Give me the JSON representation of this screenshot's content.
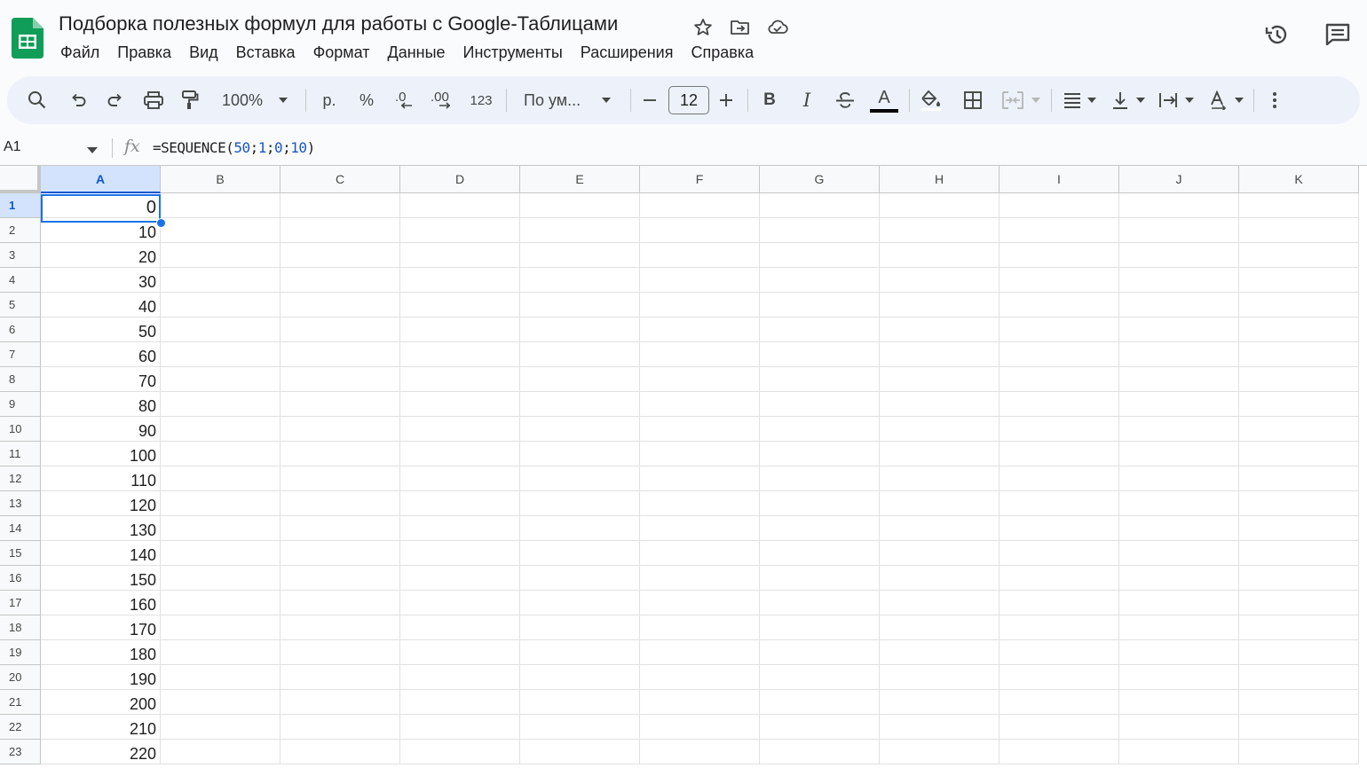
{
  "document": {
    "title": "Подборка полезных формул для работы с Google-Таблицами"
  },
  "menu": [
    "Файл",
    "Правка",
    "Вид",
    "Вставка",
    "Формат",
    "Данные",
    "Инструменты",
    "Расширения",
    "Справка"
  ],
  "toolbar": {
    "zoom": "100%",
    "currency": "р.",
    "percent": "%",
    "decrease_decimal": ".0",
    "increase_decimal": ".00",
    "number_format": "123",
    "font": "По ум...",
    "font_size": "12",
    "bold": "B",
    "italic": "I",
    "text_color": "A"
  },
  "formula_bar": {
    "cell_ref": "A1",
    "fx": "fx",
    "formula_prefix": "=SEQUENCE(",
    "arg1": "50",
    "sep1": ";",
    "arg2": "1",
    "sep2": ";",
    "arg3": "0",
    "sep3": ";",
    "arg4": "10",
    "formula_suffix": ")"
  },
  "grid": {
    "columns": [
      "A",
      "B",
      "C",
      "D",
      "E",
      "F",
      "G",
      "H",
      "I",
      "J",
      "K"
    ],
    "selected_column": "A",
    "selected_row": 1,
    "rows": [
      {
        "n": "1",
        "a": "0"
      },
      {
        "n": "2",
        "a": "10"
      },
      {
        "n": "3",
        "a": "20"
      },
      {
        "n": "4",
        "a": "30"
      },
      {
        "n": "5",
        "a": "40"
      },
      {
        "n": "6",
        "a": "50"
      },
      {
        "n": "7",
        "a": "60"
      },
      {
        "n": "8",
        "a": "70"
      },
      {
        "n": "9",
        "a": "80"
      },
      {
        "n": "10",
        "a": "90"
      },
      {
        "n": "11",
        "a": "100"
      },
      {
        "n": "12",
        "a": "110"
      },
      {
        "n": "13",
        "a": "120"
      },
      {
        "n": "14",
        "a": "130"
      },
      {
        "n": "15",
        "a": "140"
      },
      {
        "n": "16",
        "a": "150"
      },
      {
        "n": "17",
        "a": "160"
      },
      {
        "n": "18",
        "a": "170"
      },
      {
        "n": "19",
        "a": "180"
      },
      {
        "n": "20",
        "a": "190"
      },
      {
        "n": "21",
        "a": "200"
      },
      {
        "n": "22",
        "a": "210"
      },
      {
        "n": "23",
        "a": "220"
      }
    ]
  },
  "colors": {
    "accent": "#1a73e8",
    "sheets_green": "#0f9d58",
    "toolbar_bg": "#edf2fa",
    "selected_header_bg": "#d3e3fd"
  }
}
